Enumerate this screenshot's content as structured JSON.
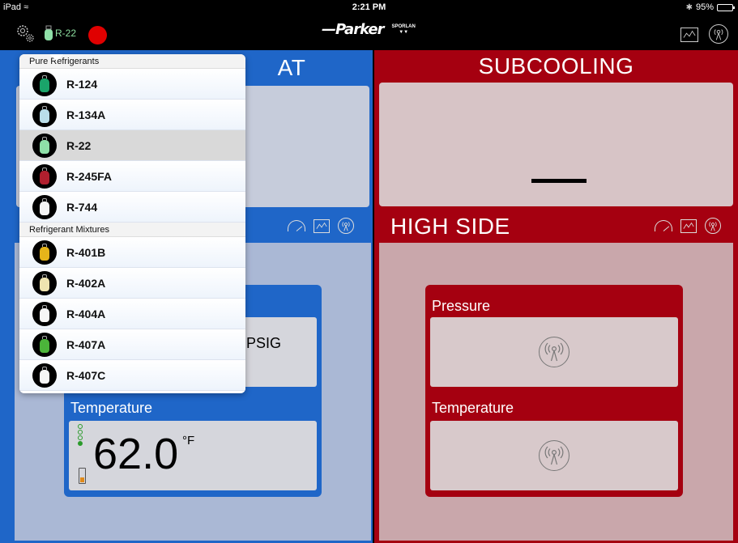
{
  "status_bar": {
    "carrier": "iPad ≈",
    "time": "2:21 PM",
    "battery": "95%",
    "battery_level": 0.95
  },
  "toolbar": {
    "refrigerant": "R-22",
    "logo_parker": "—Parker",
    "logo_sporlan": "SPORLAN"
  },
  "left": {
    "top_title_partial": "AT",
    "bottom": {
      "pressure_unit": "PSIG",
      "temperature_label": "Temperature",
      "temperature_value": "62.0",
      "temperature_unit": "°F",
      "signal_bars": 4,
      "signal_on": 1,
      "battery_level": 0.25
    }
  },
  "right": {
    "subcooling_title": "SUBCOOLING",
    "subcooling_value": "—",
    "high_side_title": "HIGH SIDE",
    "pressure_label": "Pressure",
    "temperature_label": "Temperature"
  },
  "popover": {
    "pure_header": "Pure Refrigerants",
    "mixtures_header": "Refrigerant Mixtures",
    "pure": [
      {
        "name": "R-124",
        "color": "#1aa46a"
      },
      {
        "name": "R-134A",
        "color": "#b9dde9"
      },
      {
        "name": "R-22",
        "color": "#8fe0a8"
      },
      {
        "name": "R-245FA",
        "color": "#b01f2e"
      },
      {
        "name": "R-744",
        "color": "#f4f4f4"
      }
    ],
    "mixtures": [
      {
        "name": "R-401B",
        "color": "#e5b41a"
      },
      {
        "name": "R-402A",
        "color": "#efe4b0"
      },
      {
        "name": "R-404A",
        "color": "#f6f6f6"
      },
      {
        "name": "R-407A",
        "color": "#4bb43a"
      },
      {
        "name": "R-407C",
        "color": "#f6f6f6"
      }
    ],
    "selected": "R-22"
  },
  "colors": {
    "blue": "#1f66c8",
    "red": "#a50010"
  }
}
